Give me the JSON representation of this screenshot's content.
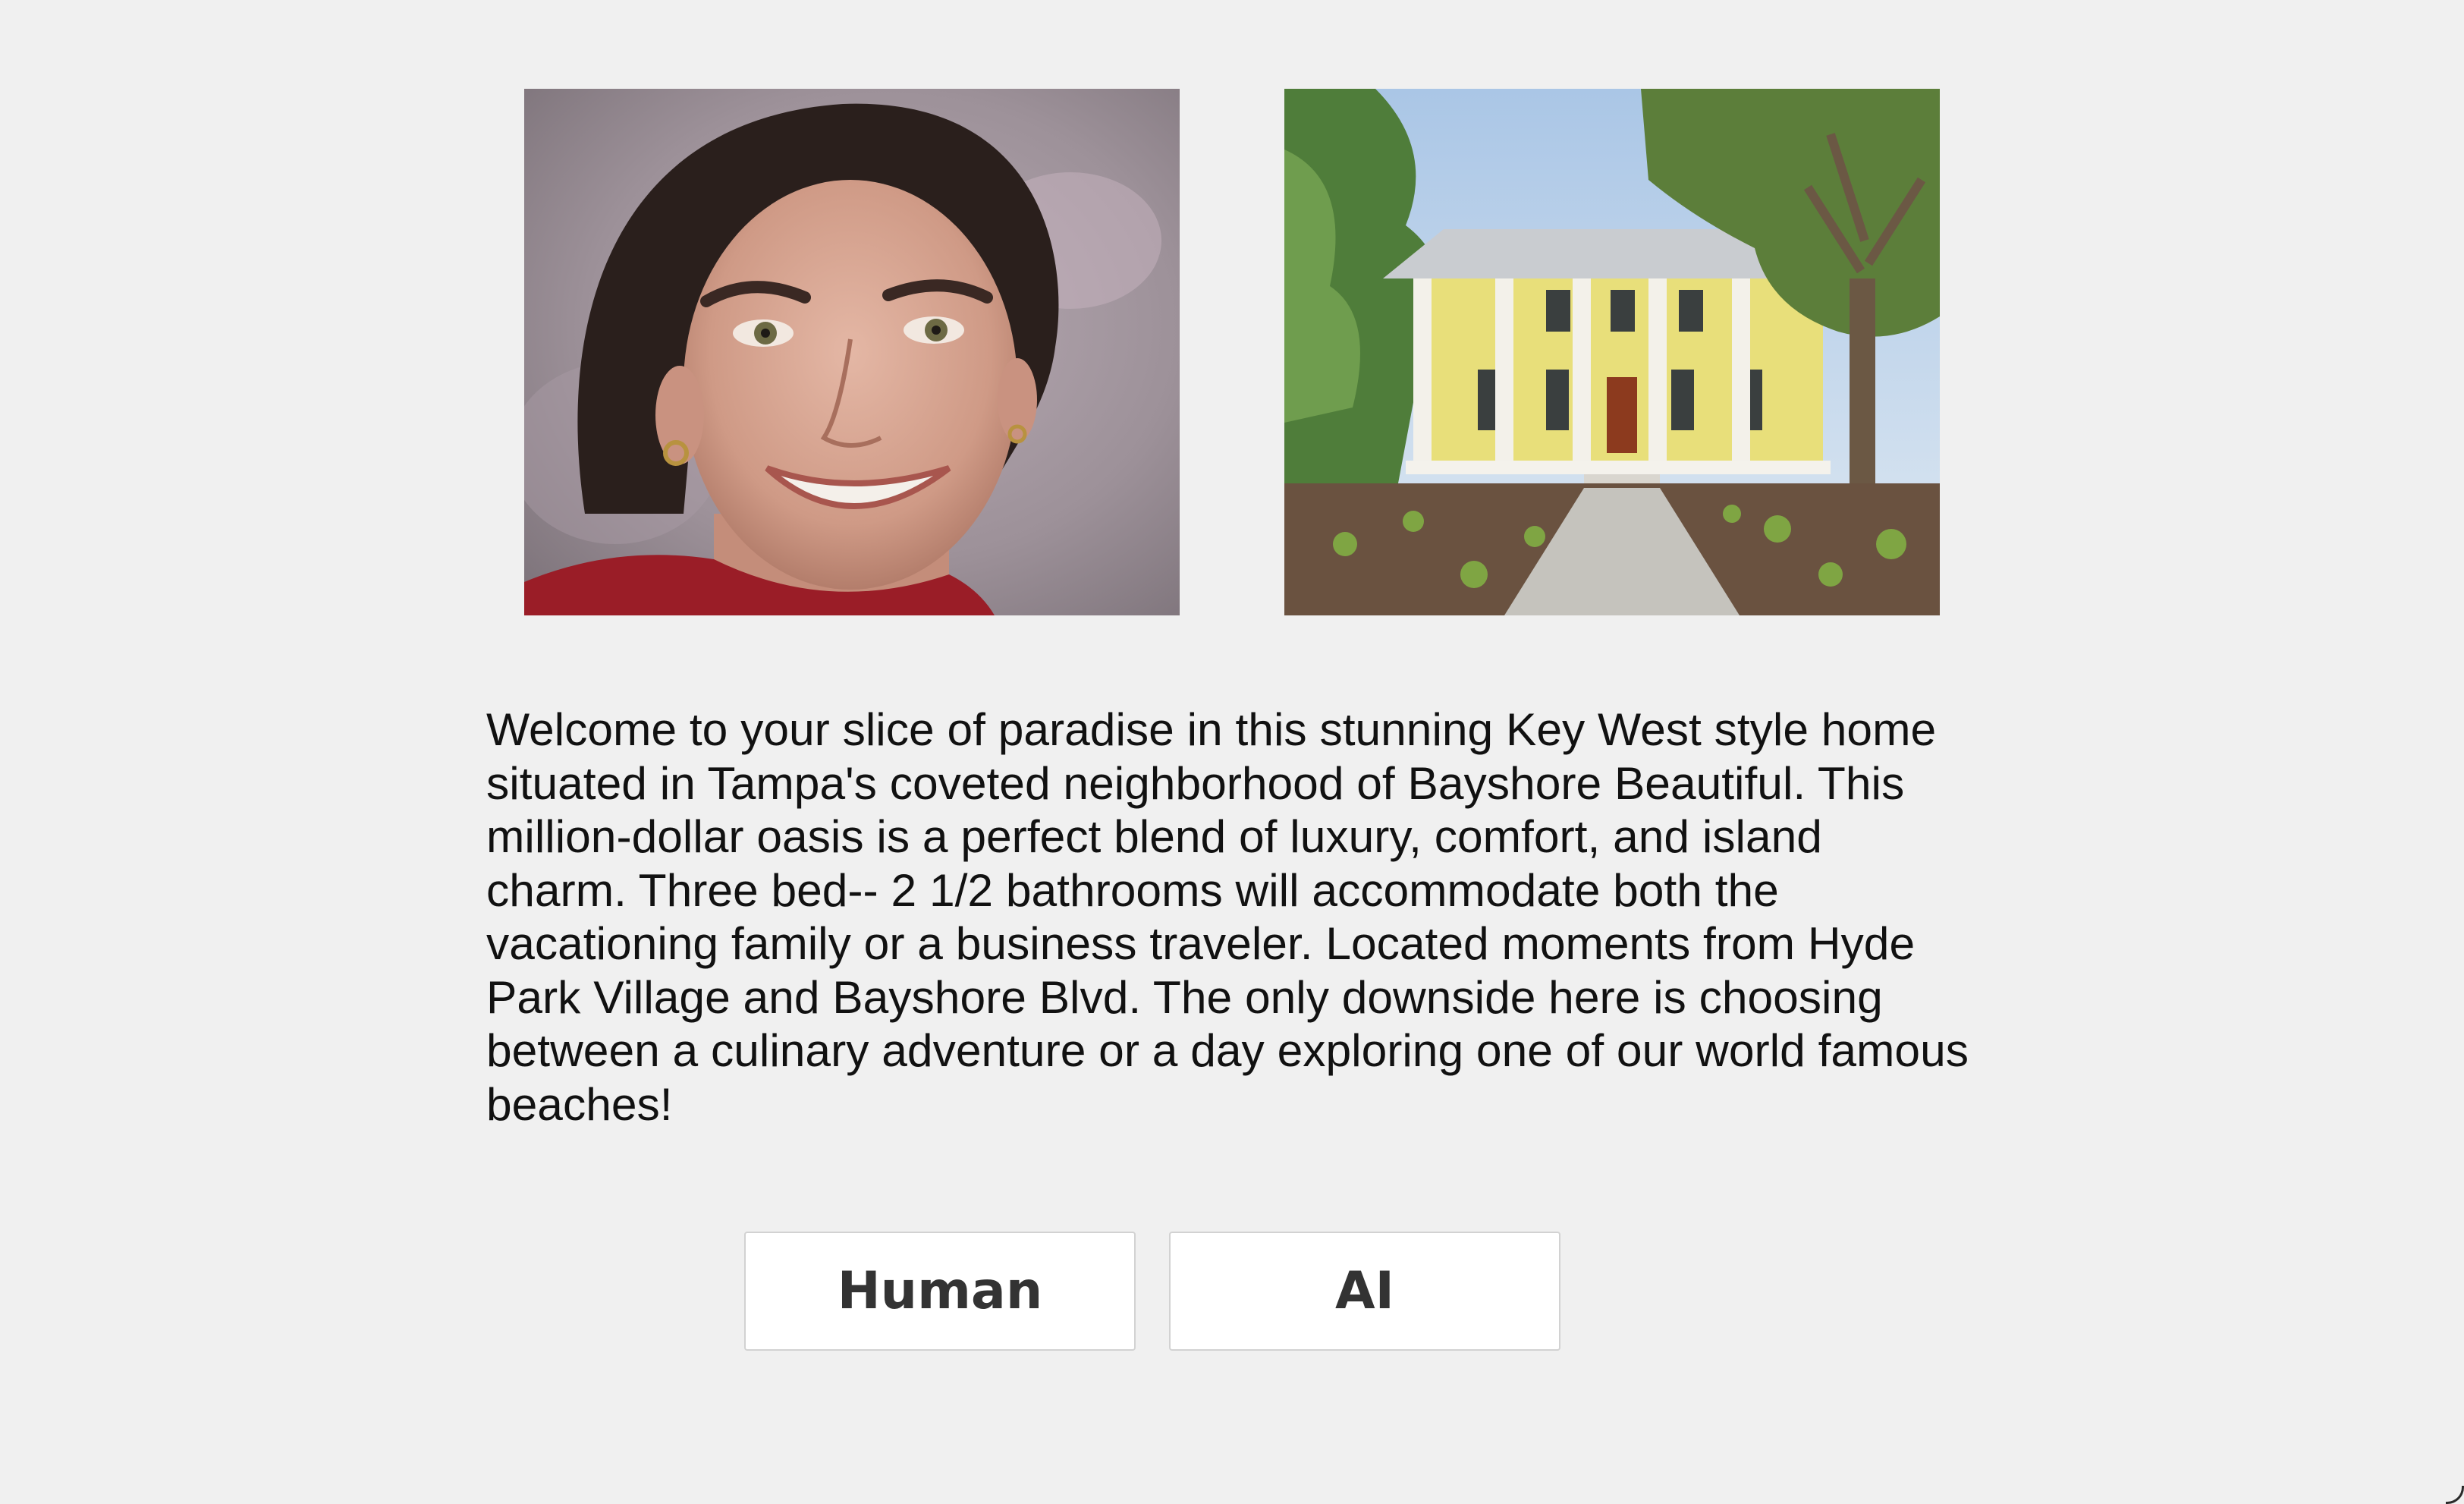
{
  "images": {
    "host_photo": {
      "icon": "person-portrait-photo"
    },
    "house_photo": {
      "icon": "house-exterior-photo"
    }
  },
  "listing": {
    "description": "Welcome to your slice of paradise in this stunning Key West style home situated in Tampa's coveted neighborhood of Bayshore Beautiful. This million-dollar oasis is a perfect blend of luxury, comfort, and island charm. Three bed-- 2 1/2 bathrooms will accommodate both the vacationing family or a business traveler. Located moments from Hyde Park Village and Bayshore Blvd. The only downside here is choosing between a culinary adventure or a day exploring one of our world famous beaches!"
  },
  "buttons": {
    "human": "Human",
    "ai": "AI"
  },
  "colors": {
    "background": "#f0f0f0",
    "button_bg": "#ffffff",
    "button_text": "#333333",
    "house_wall": "#e8df7a"
  }
}
